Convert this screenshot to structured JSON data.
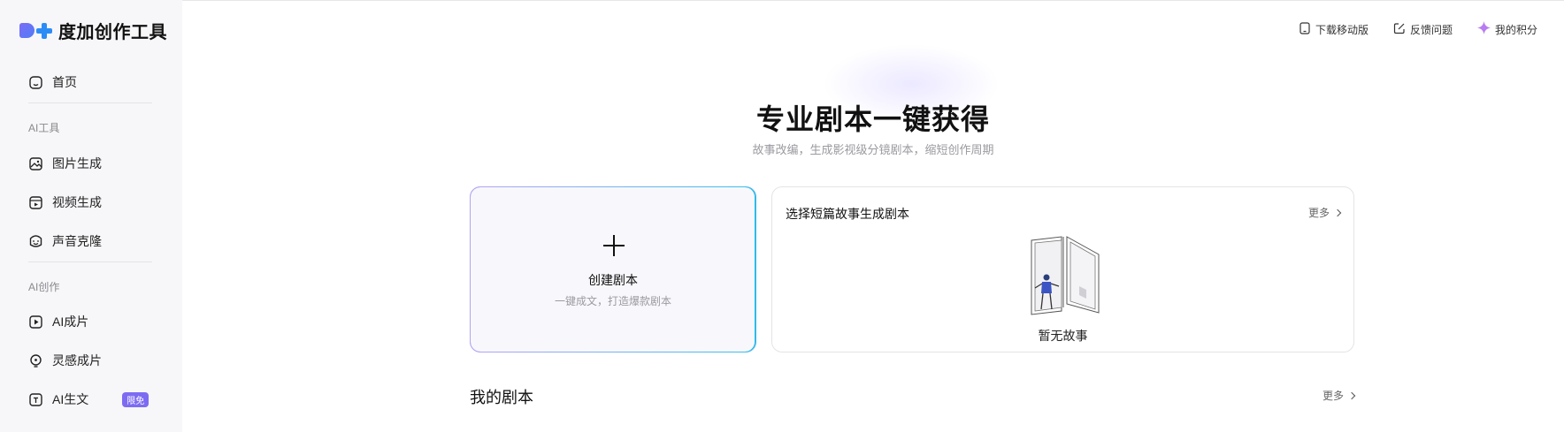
{
  "brand": {
    "name": "度加创作工具"
  },
  "sidebar": {
    "home": {
      "label": "首页",
      "icon": "home-icon"
    },
    "section_ai_tools": "AI工具",
    "ai_tools": [
      {
        "label": "图片生成",
        "icon": "image-icon"
      },
      {
        "label": "视频生成",
        "icon": "video-icon"
      },
      {
        "label": "声音克隆",
        "icon": "voice-icon"
      }
    ],
    "section_ai_create": "AI创作",
    "ai_create": [
      {
        "label": "AI成片",
        "icon": "play-icon"
      },
      {
        "label": "灵感成片",
        "icon": "bulb-icon"
      },
      {
        "label": "AI生文",
        "icon": "text-icon",
        "badge": "限免"
      }
    ]
  },
  "header": {
    "links": [
      {
        "label": "下载移动版",
        "icon": "mobile-icon"
      },
      {
        "label": "反馈问题",
        "icon": "edit-icon"
      },
      {
        "label": "我的积分",
        "icon": "sparkle-icon"
      }
    ]
  },
  "hero": {
    "title": "专业剧本一键获得",
    "subtitle": "故事改编，生成影视级分镜剧本，缩短创作周期"
  },
  "create_card": {
    "title": "创建剧本",
    "subtitle": "一键成文，打造爆款剧本"
  },
  "story_card": {
    "title": "选择短篇故事生成剧本",
    "more": "更多",
    "empty": "暂无故事"
  },
  "my_scripts": {
    "title": "我的剧本",
    "more": "更多"
  },
  "colors": {
    "accent": "#7d6cf2",
    "accent_blue": "#2c8cf6",
    "sidebar_bg": "#f7f7f9"
  }
}
